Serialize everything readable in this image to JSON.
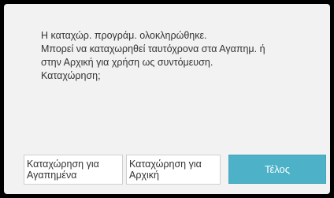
{
  "dialog": {
    "message_lines": [
      "Η καταχώρ. προγράμ. ολοκληρώθηκε.",
      "Μπορεί να καταχωρηθεί ταυτόχρονα στα Αγαπημ. ή",
      "στην Αρχική για χρήση ως συντόμευση.",
      "Καταχώρηση;"
    ],
    "buttons": {
      "favorites_line1": "Καταχώρηση για",
      "favorites_line2": "Αγαπημένα",
      "home_line1": "Καταχώρηση για",
      "home_line2": "Αρχική",
      "done": "Τέλος"
    }
  },
  "colors": {
    "background": "#000000",
    "dialog": "#f2f2f2",
    "accent_button": "#4db1c8",
    "text": "#333333"
  }
}
